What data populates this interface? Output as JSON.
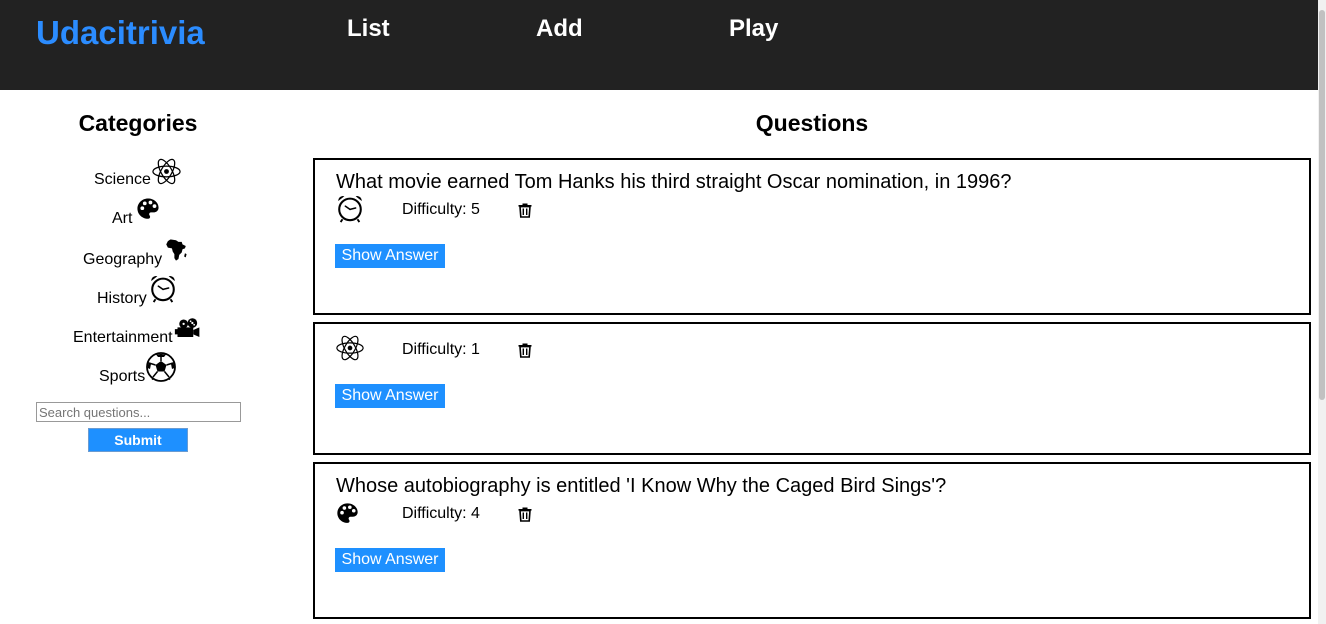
{
  "header": {
    "brand": "Udacitrivia",
    "nav": [
      {
        "label": "List"
      },
      {
        "label": "Add"
      },
      {
        "label": "Play"
      }
    ],
    "bg_color": "#222222",
    "brand_color": "#2b8cff"
  },
  "sidebar": {
    "title": "Categories",
    "categories": [
      {
        "label": "Science",
        "icon": "atom-icon"
      },
      {
        "label": "Art",
        "icon": "palette-icon"
      },
      {
        "label": "Geography",
        "icon": "africa-map-icon"
      },
      {
        "label": "History",
        "icon": "alarm-clock-icon"
      },
      {
        "label": "Entertainment",
        "icon": "film-camera-icon"
      },
      {
        "label": "Sports",
        "icon": "soccer-ball-icon"
      }
    ],
    "search": {
      "placeholder": "Search questions...",
      "value": ""
    },
    "submit_label": "Submit"
  },
  "main": {
    "title": "Questions",
    "questions": [
      {
        "text": "What movie earned Tom Hanks his third straight Oscar nomination, in 1996?",
        "category_icon": "alarm-clock-icon",
        "difficulty": "Difficulty: 5",
        "show_answer_label": "Show Answer"
      },
      {
        "text": "",
        "category_icon": "atom-icon",
        "difficulty": "Difficulty: 1",
        "show_answer_label": "Show Answer"
      },
      {
        "text": "Whose autobiography is entitled 'I Know Why the Caged Bird Sings'?",
        "category_icon": "palette-icon",
        "difficulty": "Difficulty: 4",
        "show_answer_label": "Show Answer"
      }
    ],
    "accent_color": "#1e90ff"
  }
}
